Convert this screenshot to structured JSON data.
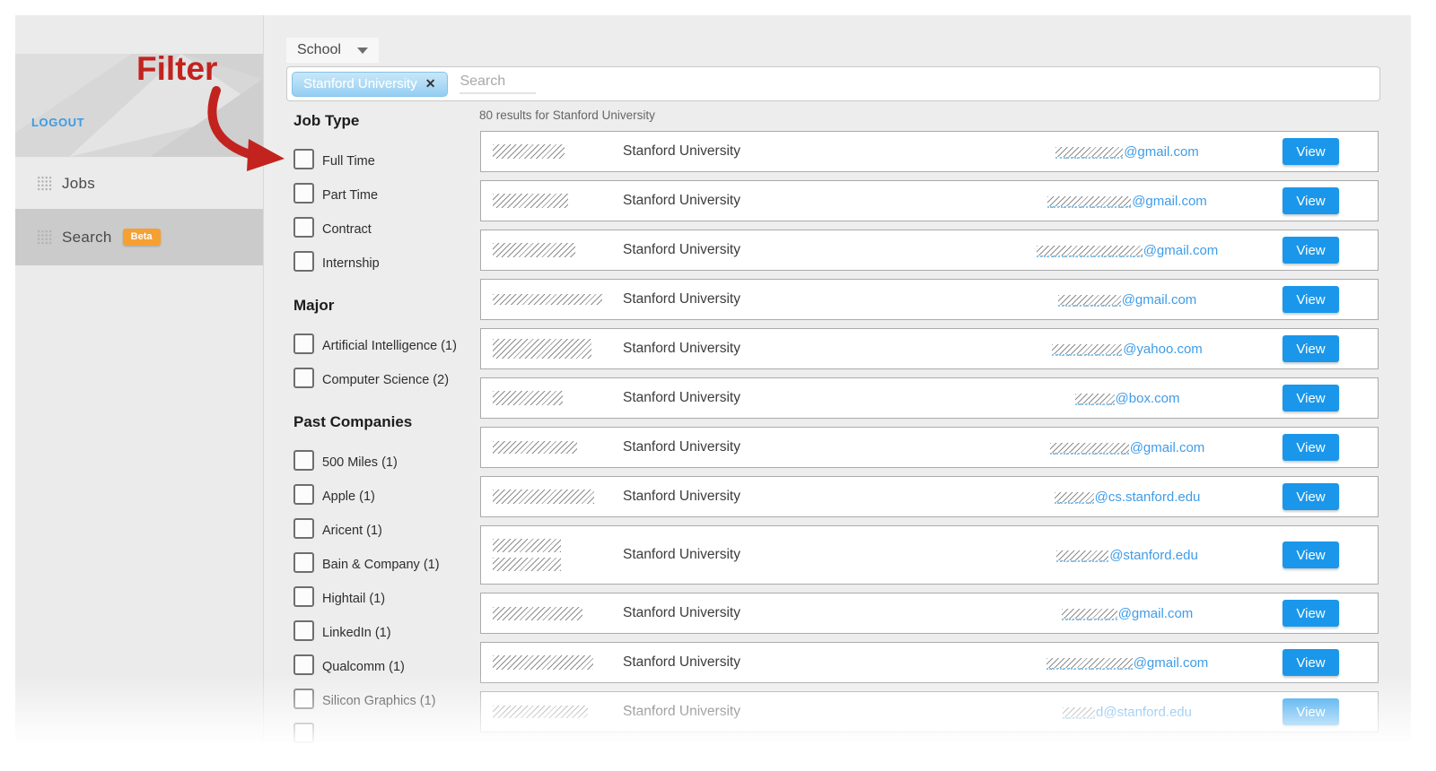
{
  "annotation": {
    "label": "Filter"
  },
  "sidebar": {
    "logout": "LOGOUT",
    "items": [
      {
        "label": "Jobs",
        "badge": ""
      },
      {
        "label": "Search",
        "badge": "Beta",
        "active": true
      }
    ]
  },
  "header": {
    "dropdown_label": "School",
    "chip": "Stanford University",
    "chip_remove": "✕",
    "search_placeholder": "Search"
  },
  "filters": {
    "sections": [
      {
        "title": "Job Type",
        "items": [
          {
            "label": "Full Time"
          },
          {
            "label": "Part Time"
          },
          {
            "label": "Contract"
          },
          {
            "label": "Internship"
          }
        ]
      },
      {
        "title": "Major",
        "items": [
          {
            "label": "Artificial Intelligence (1)"
          },
          {
            "label": "Computer Science (2)"
          }
        ]
      },
      {
        "title": "Past Companies",
        "items": [
          {
            "label": "500 Miles (1)"
          },
          {
            "label": "Apple (1)"
          },
          {
            "label": "Aricent (1)"
          },
          {
            "label": "Bain & Company (1)"
          },
          {
            "label": "Hightail (1)"
          },
          {
            "label": "LinkedIn (1)"
          },
          {
            "label": "Qualcomm (1)"
          },
          {
            "label": "Silicon Graphics (1)"
          },
          {
            "label": ""
          }
        ]
      }
    ]
  },
  "results": {
    "summary": "80 results for Stanford University",
    "view_label": "View",
    "rows": [
      {
        "school": "Stanford University",
        "email_prefix": "",
        "email_domain": "@gmail.com",
        "name_w": 80,
        "name_h": 16,
        "email_w": 75,
        "two_line": false
      },
      {
        "school": "Stanford University",
        "email_prefix": "",
        "email_domain": "@gmail.com",
        "name_w": 84,
        "name_h": 16,
        "email_w": 93,
        "two_line": false
      },
      {
        "school": "Stanford University",
        "email_prefix": "",
        "email_domain": "@gmail.com",
        "name_w": 92,
        "name_h": 16,
        "email_w": 118,
        "two_line": false
      },
      {
        "school": "Stanford University",
        "email_prefix": "",
        "email_domain": "@gmail.com",
        "name_w": 122,
        "name_h": 12,
        "email_w": 70,
        "two_line": false
      },
      {
        "school": "Stanford University",
        "email_prefix": "",
        "email_domain": "@yahoo.com",
        "name_w": 110,
        "name_h": 22,
        "email_w": 78,
        "two_line": false
      },
      {
        "school": "Stanford University",
        "email_prefix": "",
        "email_domain": "@box.com",
        "name_w": 78,
        "name_h": 16,
        "email_w": 44,
        "two_line": false
      },
      {
        "school": "Stanford University",
        "email_prefix": "",
        "email_domain": "@gmail.com",
        "name_w": 94,
        "name_h": 14,
        "email_w": 88,
        "two_line": false
      },
      {
        "school": "Stanford University",
        "email_prefix": "",
        "email_domain": "@cs.stanford.edu",
        "name_w": 113,
        "name_h": 16,
        "email_w": 44,
        "two_line": false
      },
      {
        "school": "Stanford University",
        "email_prefix": "",
        "email_domain": "@stanford.edu",
        "name_w": 76,
        "name_h": 15,
        "email_w": 58,
        "two_line": true
      },
      {
        "school": "Stanford University",
        "email_prefix": "",
        "email_domain": "@gmail.com",
        "name_w": 100,
        "name_h": 15,
        "email_w": 62,
        "two_line": false
      },
      {
        "school": "Stanford University",
        "email_prefix": "",
        "email_domain": "@gmail.com",
        "name_w": 112,
        "name_h": 16,
        "email_w": 96,
        "two_line": false
      },
      {
        "school": "Stanford University",
        "email_prefix": "d",
        "email_domain": "@stanford.edu",
        "name_w": 106,
        "name_h": 14,
        "email_w": 36,
        "two_line": false
      }
    ]
  },
  "colors": {
    "view_button": "#1a97ea",
    "email_link": "#3f9ce8",
    "beta_badge": "#f5a033",
    "annotation_red": "#c2231f",
    "logout_blue": "#3a9ce1"
  }
}
